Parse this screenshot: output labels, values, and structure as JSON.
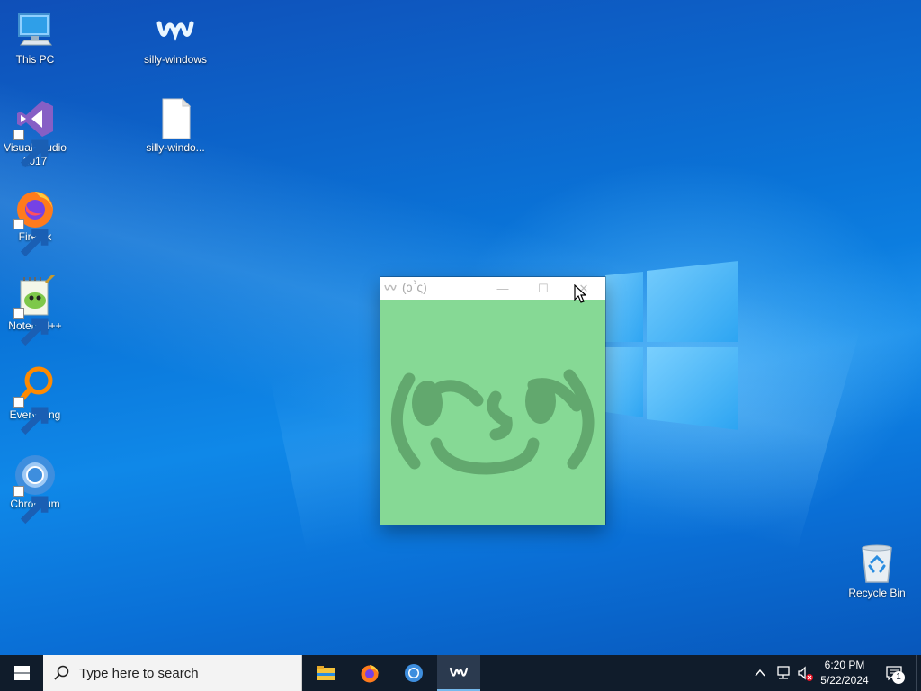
{
  "desktop": {
    "icons": [
      {
        "label": "This PC",
        "icon": "computer-icon"
      },
      {
        "label": "silly-windows",
        "icon": "silly-windows-logo-icon"
      },
      {
        "label": "Visual Studio 2017",
        "icon": "visual-studio-icon"
      },
      {
        "label": "silly-windo...",
        "icon": "file-icon"
      },
      {
        "label": "Firefox",
        "icon": "firefox-icon"
      },
      {
        "label": "Notepad++",
        "icon": "notepad-plus-plus-icon"
      },
      {
        "label": "Everything",
        "icon": "everything-search-icon"
      },
      {
        "label": "Chromium",
        "icon": "chromium-icon"
      },
      {
        "label": "Recycle Bin",
        "icon": "recycle-bin-icon"
      }
    ]
  },
  "app_window": {
    "title": "(ↄˋ̀ς)",
    "face_glyph": "(ʘ‿ʘ)",
    "background_color": "#86d995",
    "face_color": "#62a86e",
    "buttons": {
      "minimize": "—",
      "maximize": "☐",
      "close": "✕"
    }
  },
  "taskbar": {
    "search_placeholder": "Type here to search",
    "pinned": [
      "file-explorer-icon",
      "firefox-icon",
      "chromium-icon",
      "silly-windows-icon"
    ],
    "clock_time": "6:20 PM",
    "clock_date": "5/22/2024",
    "notification_count": "1"
  },
  "colors": {
    "taskbar_bg": "#101c2b",
    "accent": "#76b9ed"
  }
}
